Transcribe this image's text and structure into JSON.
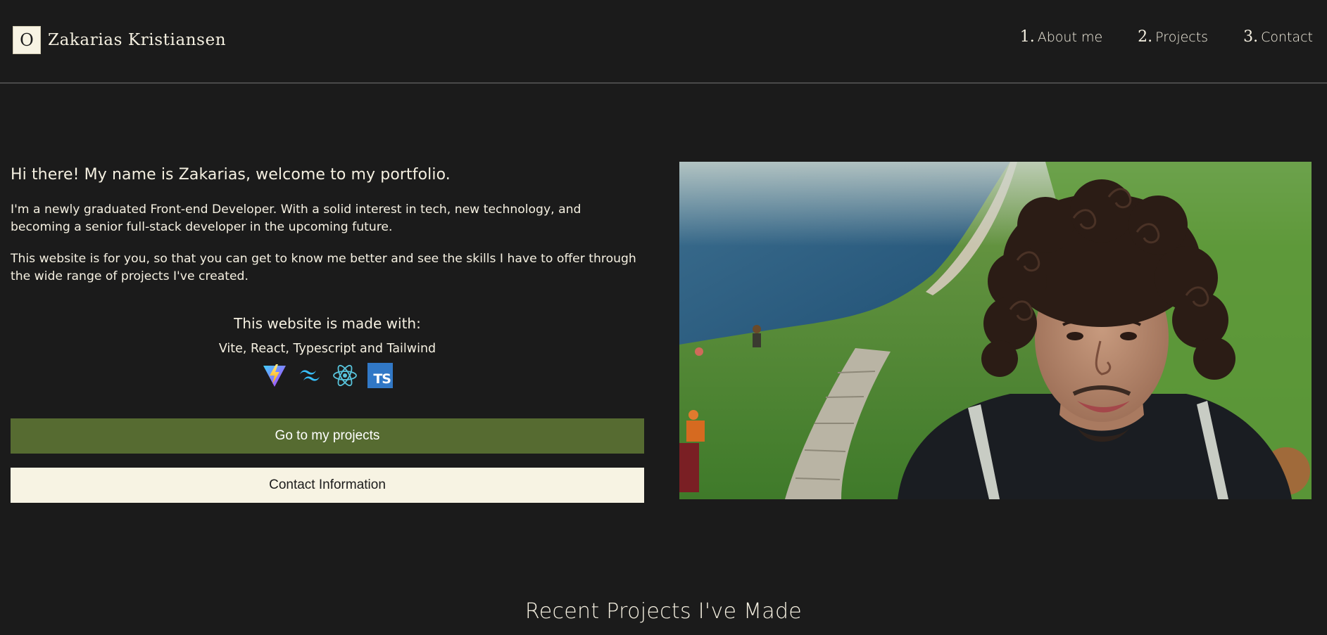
{
  "brand": {
    "logo_letter": "O",
    "name": "Zakarias Kristiansen"
  },
  "nav": {
    "items": [
      {
        "num": "1.",
        "label": "About me"
      },
      {
        "num": "2.",
        "label": "Projects"
      },
      {
        "num": "3.",
        "label": "Contact"
      }
    ]
  },
  "hero": {
    "greeting": "Hi there! My name is Zakarias, welcome to my portfolio.",
    "paragraph_1": "I'm a newly graduated Front-end Developer. With a solid interest in tech, new technology, and becoming a senior full-stack developer in the upcoming future.",
    "paragraph_2": "This website is for you, so that you can get to know me better and see the skills I have to offer through the wide range of projects I've created."
  },
  "made_with": {
    "title": "This website is made with:",
    "list": "Vite, React, Typescript and Tailwind",
    "icons": [
      "vite-icon",
      "tailwind-icon",
      "react-icon",
      "typescript-icon"
    ],
    "ts_label": "TS"
  },
  "buttons": {
    "projects_label": "Go to my projects",
    "contact_label": "Contact Information"
  },
  "recent": {
    "title": "Recent Projects I've Made"
  },
  "colors": {
    "background": "#1b1b1b",
    "text": "#f5f0e1",
    "accent_green": "#566b31",
    "cream": "#f7f3e3",
    "typescript_blue": "#3178c6",
    "react_cyan": "#58c4dc",
    "tailwind_teal": "#38bdf8"
  }
}
